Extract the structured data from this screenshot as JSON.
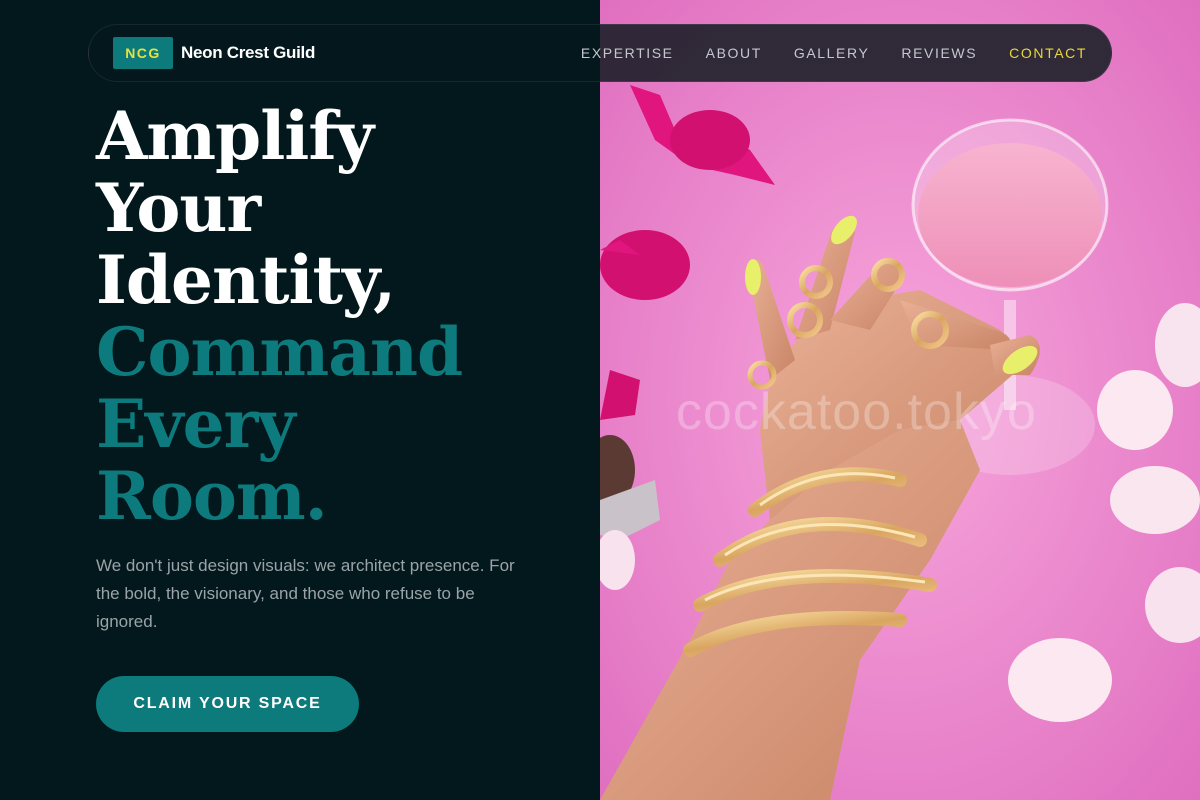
{
  "nav": {
    "logo_badge": "NCG",
    "brand": "Neon Crest Guild",
    "links": [
      {
        "label": "EXPERTISE"
      },
      {
        "label": "ABOUT"
      },
      {
        "label": "GALLERY"
      },
      {
        "label": "REVIEWS"
      },
      {
        "label": "CONTACT",
        "active": true
      }
    ]
  },
  "hero": {
    "headline_white": [
      "Amplify",
      "Your",
      "Identity,"
    ],
    "headline_teal": [
      "Command",
      "Every",
      "Room."
    ],
    "subtext": "We don't just design visuals: we architect presence. For the bold, the visionary, and those who refuse to be ignored.",
    "cta_label": "CLAIM YOUR SPACE"
  },
  "photo": {
    "watermark": "cockatoo.tokyo"
  },
  "colors": {
    "background": "#03181c",
    "accent_teal": "#0d7a7c",
    "accent_yellow": "#e8d83a",
    "photo_pink": "#ef86cf"
  }
}
